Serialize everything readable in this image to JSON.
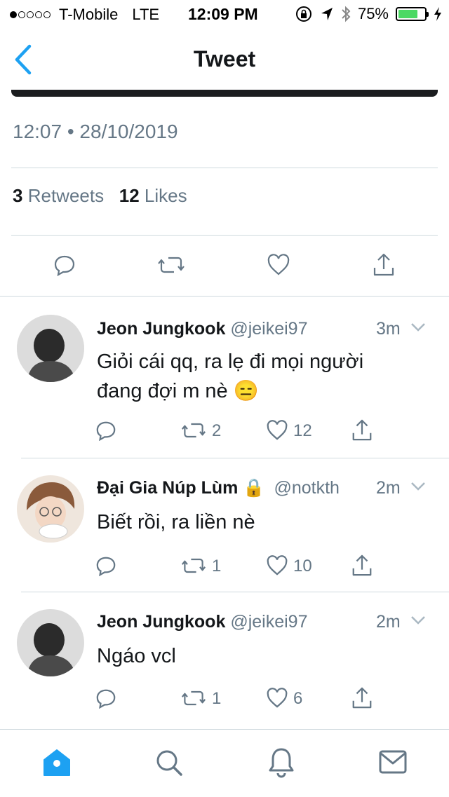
{
  "status_bar": {
    "carrier": "T-Mobile",
    "network": "LTE",
    "time": "12:09 PM",
    "battery_percent": "75%",
    "battery_level": 0.75,
    "signal_dots_filled": 1,
    "signal_dots_total": 5
  },
  "nav": {
    "title": "Tweet"
  },
  "tweet": {
    "timestamp": "12:07 • 28/10/2019",
    "retweets_count": "3",
    "retweets_label": "Retweets",
    "likes_count": "12",
    "likes_label": "Likes"
  },
  "replies": [
    {
      "name": "Jeon Jungkook",
      "handle": "@jeikei97",
      "time": "3m",
      "text_line1": "Giỏi cái qq, ra lẹ đi mọi người",
      "text_line2": "đang đợi m nè 😑",
      "retweets": "2",
      "likes": "12"
    },
    {
      "name": "Đại Gia Núp Lùm",
      "lock": "🔒",
      "handle": "@notkth",
      "time": "2m",
      "text_line1": "Biết rồi, ra liền nè",
      "retweets": "1",
      "likes": "10"
    },
    {
      "name": "Jeon Jungkook",
      "handle": "@jeikei97",
      "time": "2m",
      "text_line1": "Ngáo vcl",
      "retweets": "1",
      "likes": "6"
    }
  ],
  "colors": {
    "accent": "#1da1f2",
    "secondary_text": "#657786",
    "divider": "#cfd9de",
    "battery_fill": "#4cd964"
  },
  "icons": {
    "nav_back": "chevron-left-icon",
    "tabs": [
      "home-icon",
      "search-icon",
      "bell-icon",
      "mail-icon"
    ]
  }
}
